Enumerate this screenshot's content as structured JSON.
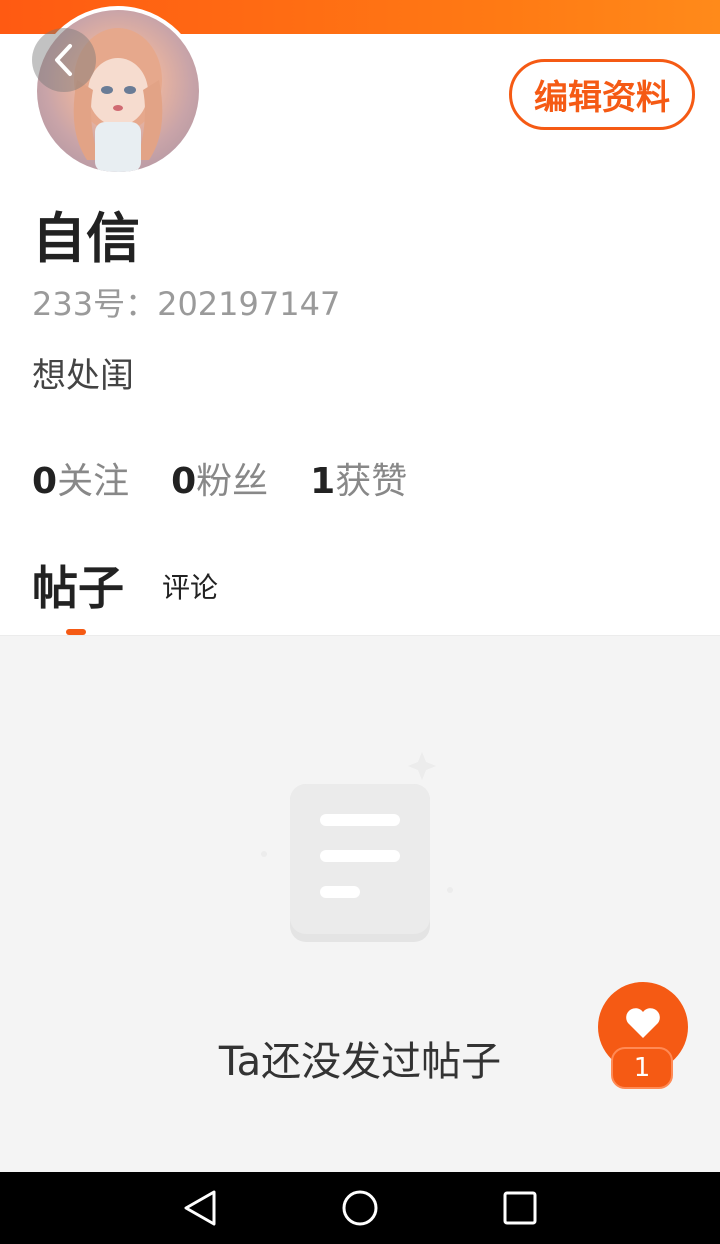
{
  "profile": {
    "name": "自信",
    "id_text": "233号：202197147",
    "bio": "想处闺",
    "edit_button": "编辑资料"
  },
  "stats": [
    {
      "count": "0",
      "label": "关注"
    },
    {
      "count": "0",
      "label": "粉丝"
    },
    {
      "count": "1",
      "label": "获赞"
    }
  ],
  "tabs": {
    "posts": "帖子",
    "comments": "评论"
  },
  "empty_state": {
    "text": "Ta还没发过帖子"
  },
  "like_fab": {
    "count": "1"
  },
  "icons": {
    "back": "chevron-left-icon",
    "like": "heart-icon",
    "empty": "document-icon",
    "nav_back": "triangle-back-icon",
    "nav_home": "circle-home-icon",
    "nav_recent": "square-recent-icon"
  },
  "colors": {
    "accent": "#f55a14",
    "top_bar": "#ff6a14",
    "content_bg": "#f4f4f4"
  }
}
